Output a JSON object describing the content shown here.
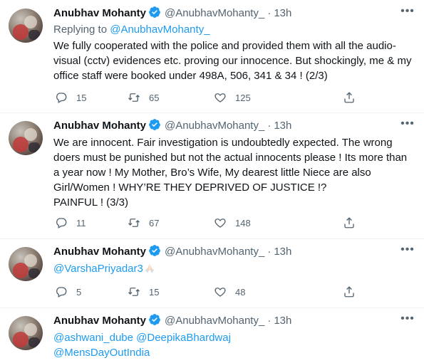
{
  "author": {
    "name": "Anubhav Mohanty",
    "handle": "@AnubhavMohanty_",
    "avatar_icon": "profile-photo",
    "verified_icon": "verified-badge-icon"
  },
  "tweets": [
    {
      "time": "13h",
      "replying_prefix": "Replying to",
      "replying_to": "@AnubhavMohanty_",
      "text": "We fully cooperated with the police and provided them with all the audio-visual (cctv) evidences etc. proving our innocence. But shockingly, me & my office staff were booked under 498A, 506, 341 & 34 ! (2/3)",
      "replies": "15",
      "retweets": "65",
      "likes": "125"
    },
    {
      "time": "13h",
      "text": "We are innocent. Fair investigation is undoubtedly expected. The wrong doers must be punished but not the actual innocents please ! Its more than a year now ! My Mother, Bro’s Wife, My dearest little Niece are also Girl/Women ! WHY’RE THEY DEPRIVED OF JUSTICE !?\nPAINFUL ! (3/3)",
      "replies": "11",
      "retweets": "67",
      "likes": "148"
    },
    {
      "time": "13h",
      "mention": "@VarshaPriyadar3",
      "emoji": "folded-hands",
      "replies": "5",
      "retweets": "15",
      "likes": "48"
    },
    {
      "time": "13h",
      "mentions_line1": "@ashwani_dube @DeepikaBhardwaj",
      "mentions_line2": "@MensDayOutIndia"
    }
  ],
  "colors": {
    "text": "#0f1419",
    "secondary": "#536471",
    "link": "#1d9bf0",
    "verified": "#1d9bf0",
    "divider": "#eff3f4"
  },
  "more_icon": "more-horizontal-icon"
}
